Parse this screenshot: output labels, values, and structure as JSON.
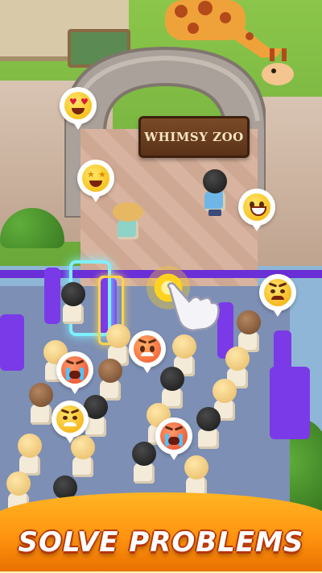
{
  "scene": {
    "sign_text": "WHIMSY ZOO",
    "banner_text": "SOLVE PROBLEMS"
  },
  "colors": {
    "banner_orange": "#ff9410",
    "sign_wood": "#6b3f22",
    "path_stone": "#d7b7a2",
    "queue_floor": "#7d8fb4",
    "fence_purple": "#6a2fd6",
    "grass": "#7fc443"
  },
  "reactions": [
    {
      "name": "heart-eyes-emoji",
      "type": "love"
    },
    {
      "name": "star-struck-emoji",
      "type": "star"
    },
    {
      "name": "grinning-emoji",
      "type": "happy"
    },
    {
      "name": "annoyed-emoji",
      "type": "annoyed"
    },
    {
      "name": "angry-emoji",
      "type": "angry"
    },
    {
      "name": "crying-angry-emoji",
      "type": "crying"
    },
    {
      "name": "mad-emoji",
      "type": "mad"
    },
    {
      "name": "crying-angry-emoji-2",
      "type": "crying"
    }
  ],
  "icons": {
    "pointer": "pointing-hand-icon",
    "tap": "tap-ripple-icon"
  }
}
